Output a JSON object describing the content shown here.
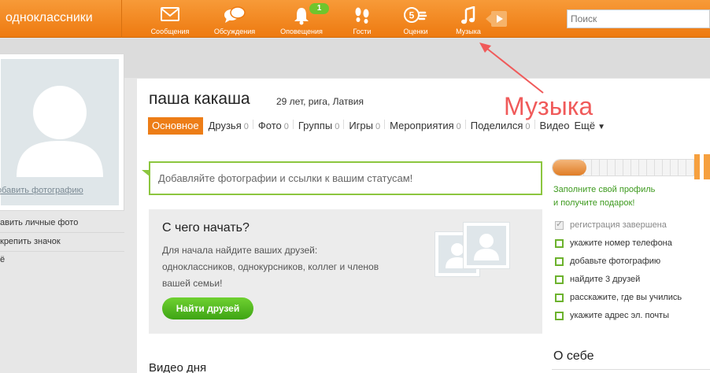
{
  "topbar": {
    "logo": "одноклассники",
    "nav": [
      {
        "label": "Сообщения",
        "icon": "envelope-icon"
      },
      {
        "label": "Обсуждения",
        "icon": "chat-bubbles-icon"
      },
      {
        "label": "Оповещения",
        "icon": "bell-icon",
        "badge": "1"
      },
      {
        "label": "Гости",
        "icon": "footprints-icon"
      },
      {
        "label": "Оценки",
        "icon": "rating-five-icon"
      },
      {
        "label": "Музыка",
        "icon": "music-note-icon"
      }
    ],
    "play_icon": "play-icon",
    "search_placeholder": "Поиск"
  },
  "left": {
    "add_photo": "обавить фотографию",
    "links": [
      "авить личные фото",
      "крепить значок",
      "ё"
    ]
  },
  "profile": {
    "name": "паша какаша",
    "info": "29 лет, рига, Латвия",
    "tabs": [
      {
        "label": "Основное",
        "count": ""
      },
      {
        "label": "Друзья",
        "count": "0"
      },
      {
        "label": "Фото",
        "count": "0"
      },
      {
        "label": "Группы",
        "count": "0"
      },
      {
        "label": "Игры",
        "count": "0"
      },
      {
        "label": "Мероприятия",
        "count": "0"
      },
      {
        "label": "Поделился",
        "count": "0"
      },
      {
        "label": "Видео",
        "count": ""
      },
      {
        "label": "Ещё",
        "count": ""
      }
    ]
  },
  "status": {
    "placeholder": "Добавляйте фотографии и ссылки к вашим статусам!"
  },
  "start": {
    "title": "С чего начать?",
    "text": "Для начала найдите ваших друзей: одноклассников, однокурсников, коллег и членов вашей семьи!",
    "button": "Найти друзей"
  },
  "video": {
    "title": "Видео дня"
  },
  "progress": {
    "fill_fraction": 0.23
  },
  "right": {
    "hint_line1": "Заполните свой профиль",
    "hint_line2": "и получите подарок!",
    "checklist": [
      {
        "label": "регистрация завершена",
        "done": true
      },
      {
        "label": "укажите номер телефона",
        "done": false
      },
      {
        "label": "добавьте фотографию",
        "done": false
      },
      {
        "label": "найдите 3 друзей",
        "done": false
      },
      {
        "label": "расскажите, где вы учились",
        "done": false
      },
      {
        "label": "укажите адрес эл. почты",
        "done": false
      }
    ],
    "about_title": "О себе"
  },
  "annotation": {
    "text": "Музыка",
    "color": "#f05a5a"
  },
  "colors": {
    "brand": "#ee7a10",
    "accent_green": "#8cc63f",
    "button_green": "#3ea414"
  }
}
